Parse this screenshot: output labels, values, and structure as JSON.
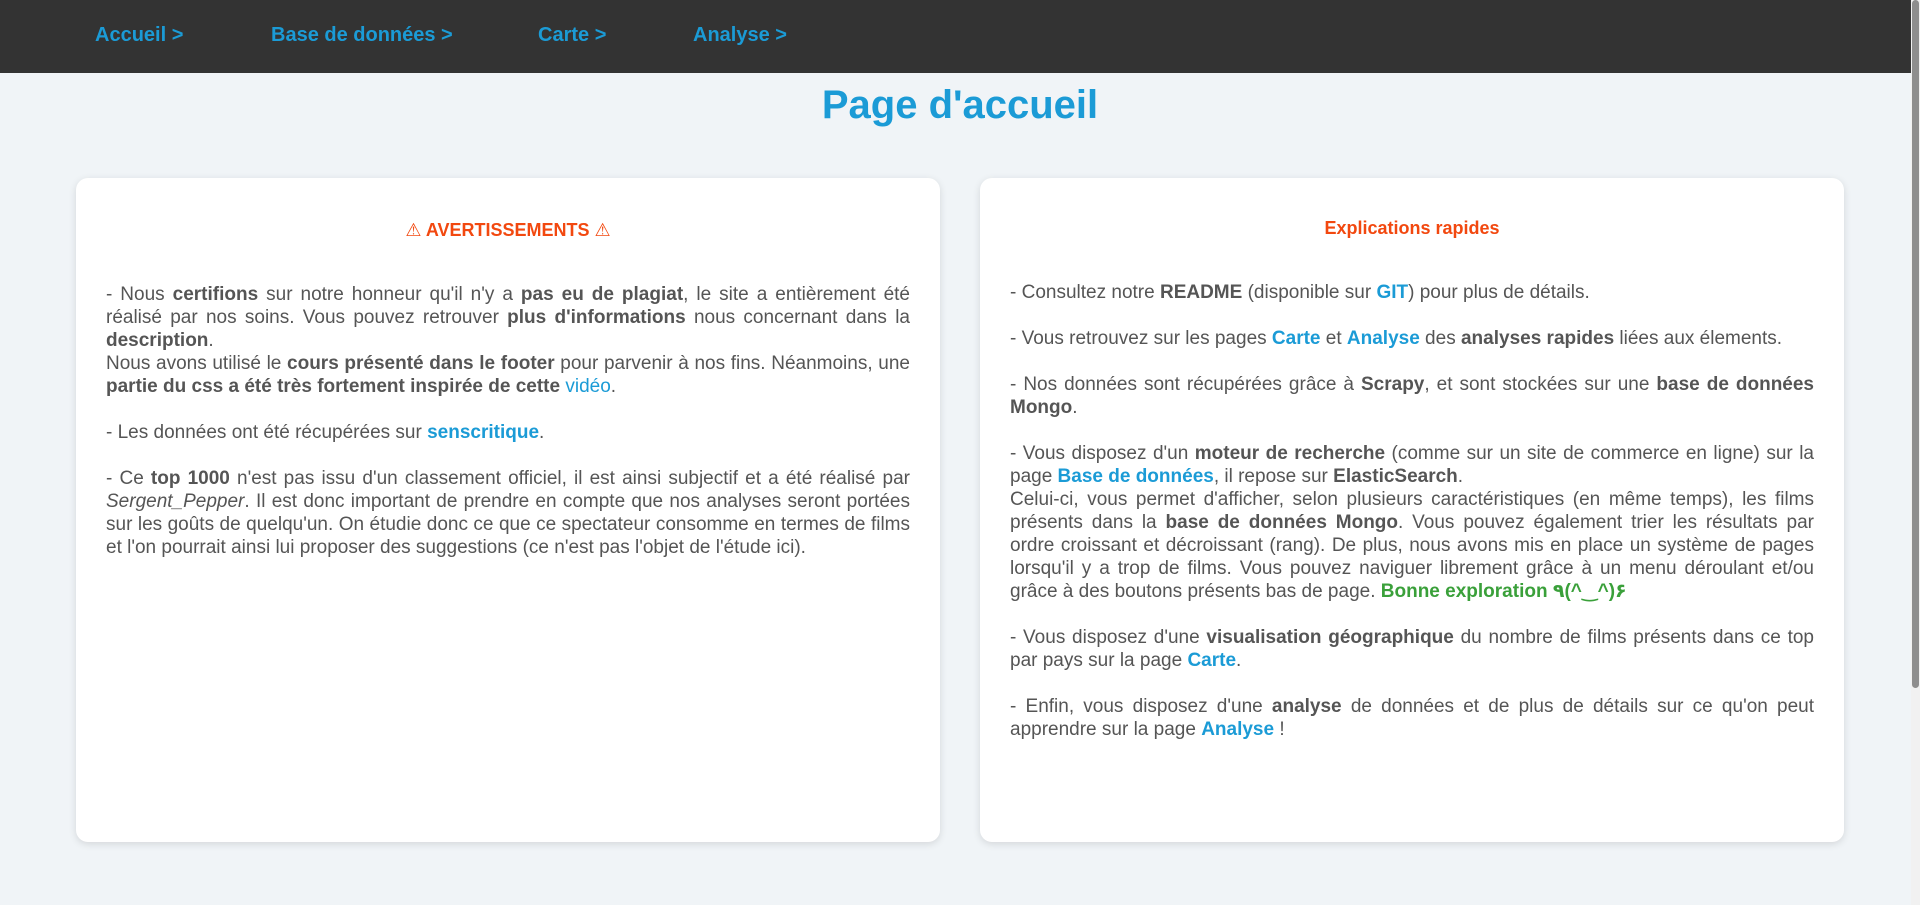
{
  "nav": {
    "items": [
      {
        "label": "Accueil >"
      },
      {
        "label": "Base de données >"
      },
      {
        "label": "Carte >"
      },
      {
        "label": "Analyse >"
      }
    ]
  },
  "page": {
    "title": "Page d'accueil"
  },
  "warnings": {
    "title": "⚠ AVERTISSEMENTS ⚠",
    "p1": {
      "t1": "- Nous ",
      "b1": "certifions",
      "t2": " sur notre honneur qu'il n'y a ",
      "b2": "pas eu de plagiat",
      "t3": ", le site a entièrement été réalisé par nos soins. Vous pouvez retrouver ",
      "b3": "plus d'informations",
      "t4": " nous concernant dans la ",
      "b4": "description",
      "t5": ".",
      "t6": "Nous avons utilisé le ",
      "b5": "cours présenté dans le footer",
      "t7": " pour parvenir à nos fins. Néanmoins, une ",
      "b6": "partie du css a été très fortement inspirée de cette",
      "t8": " ",
      "link": "vidéo",
      "t9": "."
    },
    "p2": {
      "t1": "- Les données ont été récupérées sur ",
      "link": "senscritique",
      "t2": "."
    },
    "p3": {
      "t1": "- Ce ",
      "b1": "top 1000",
      "t2": " n'est pas issu d'un classement officiel, il est ainsi subjectif et a été réalisé par ",
      "i1": "Sergent_Pepper",
      "t3": ". Il est donc important de prendre en compte que nos analyses seront portées sur les goûts de quelqu'un. On étudie donc ce que ce spectateur consomme en termes de films et l'on pourrait ainsi lui proposer des suggestions (ce n'est pas l'objet de l'étude ici)."
    }
  },
  "explanations": {
    "title": "Explications rapides",
    "p1": {
      "t1": "- Consultez notre ",
      "b1": "README",
      "t2": " (disponible sur ",
      "link": "GIT",
      "t3": ") pour plus de détails."
    },
    "p2": {
      "t1": "- Vous retrouvez sur les pages ",
      "link1": "Carte",
      "t2": " et ",
      "link2": "Analyse",
      "t3": " des ",
      "b1": "analyses rapides",
      "t4": " liées aux élements."
    },
    "p3": {
      "t1": "- Nos données sont récupérées grâce à ",
      "b1": "Scrapy",
      "t2": ", et sont stockées sur une ",
      "b2": "base de données Mongo",
      "t3": "."
    },
    "p4": {
      "t1": "- Vous disposez d'un ",
      "b1": "moteur de recherche",
      "t2": " (comme sur un site de commerce en ligne) sur la page ",
      "link": "Base de données",
      "t3": ", il repose sur ",
      "b2": "ElasticSearch",
      "t4": ".",
      "t5": "Celui-ci, vous permet d'afficher, selon plusieurs caractéristiques (en même temps), les films présents dans la ",
      "b3": "base de données Mongo",
      "t6": ". Vous pouvez également trier les résultats par ordre croissant et décroissant (rang). De plus, nous avons mis en place un système de pages lorsqu'il y a trop de films. Vous pouvez naviguer librement grâce à un menu déroulant et/ou grâce à des boutons présents bas de page. ",
      "green": "Bonne exploration ٩(^‿^)۶"
    },
    "p5": {
      "t1": "- Vous disposez d'une ",
      "b1": "visualisation géographique",
      "t2": " du nombre de films présents dans ce top par pays sur la page ",
      "link": "Carte",
      "t3": "."
    },
    "p6": {
      "t1": "- Enfin, vous disposez d'une ",
      "b1": "analyse",
      "t2": " de données et de plus de détails sur ce qu'on peut apprendre sur la page ",
      "link": "Analyse",
      "t3": " !"
    }
  },
  "colors": {
    "navbar": "#333333",
    "link": "#1b9bd6",
    "warning": "#f2480f",
    "green": "#3aa03a",
    "background": "#f0f4f7"
  }
}
